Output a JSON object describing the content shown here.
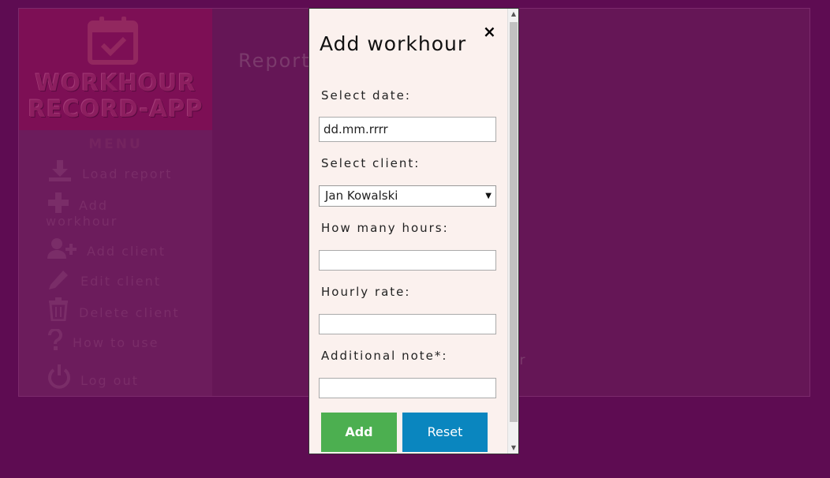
{
  "app": {
    "logo_text_line1": "WORKHOUR",
    "logo_text_line2": "RECORD-APP",
    "menu_title": "MENU",
    "menu_items": [
      {
        "label": "Load report",
        "icon": "download-icon"
      },
      {
        "label": "Add",
        "label2": "workhour",
        "icon": "plus-icon"
      },
      {
        "label": "Add client",
        "icon": "add-user-icon"
      },
      {
        "label": "Edit client",
        "icon": "pencil-icon"
      },
      {
        "label": "Delete client",
        "icon": "trash-icon"
      },
      {
        "label": "How to use",
        "icon": "question-icon"
      },
      {
        "label": "Log out",
        "icon": "power-icon"
      }
    ],
    "report_heading": "Report",
    "partial_text": "er"
  },
  "modal": {
    "title": "Add workhour",
    "close_symbol": "×",
    "date_label": "Select date:",
    "date_value": "dd.mm.rrrr",
    "client_label": "Select client:",
    "client_selected": "Jan Kowalski",
    "hours_label": "How many hours:",
    "hours_value": "",
    "rate_label": "Hourly rate:",
    "rate_value": "",
    "note_label": "Additional note*:",
    "note_value": "",
    "add_button": "Add",
    "reset_button": "Reset"
  },
  "colors": {
    "background": "#5e0c52",
    "modal_bg": "#fbf1ee",
    "add_button": "#4caf50",
    "reset_button": "#0a86bf"
  }
}
